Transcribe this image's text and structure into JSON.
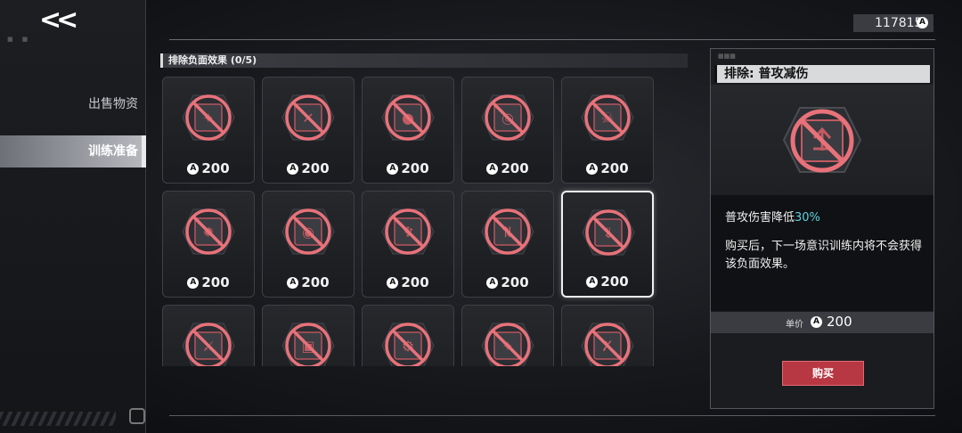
{
  "nav": {
    "back_label": "<<"
  },
  "sidebar": {
    "items": [
      {
        "label": "出售物资",
        "active": false
      },
      {
        "label": "训练准备",
        "active": true
      }
    ]
  },
  "currency": {
    "amount": "117815",
    "icon": "A"
  },
  "section": {
    "title": "排除负面效果 (0/5)"
  },
  "grid": {
    "cards": [
      {
        "price": "200",
        "icon": "no-star-badge-icon",
        "selected": false
      },
      {
        "price": "200",
        "icon": "no-broken-shield-icon",
        "selected": false
      },
      {
        "price": "200",
        "icon": "no-bomb-icon",
        "selected": false
      },
      {
        "price": "200",
        "icon": "no-aperture-icon",
        "selected": false
      },
      {
        "price": "200",
        "icon": "no-skull-icon",
        "selected": false
      },
      {
        "price": "200",
        "icon": "no-flame-burst-icon",
        "selected": false
      },
      {
        "price": "200",
        "icon": "no-vortex-icon",
        "selected": false
      },
      {
        "price": "200",
        "icon": "no-demon-icon",
        "selected": false
      },
      {
        "price": "200",
        "icon": "no-swap-arrows-icon",
        "selected": false
      },
      {
        "price": "200",
        "icon": "no-attack-down-icon",
        "selected": true
      },
      {
        "price": "",
        "icon": "no-sword-icon",
        "selected": false
      },
      {
        "price": "",
        "icon": "no-cube-icon",
        "selected": false
      },
      {
        "price": "",
        "icon": "no-gear-skull-icon",
        "selected": false
      },
      {
        "price": "",
        "icon": "no-compass-icon",
        "selected": false
      },
      {
        "price": "",
        "icon": "no-crossed-icon",
        "selected": false
      }
    ]
  },
  "detail": {
    "title": "排除: 普攻减伤",
    "icon": "no-attack-down-icon",
    "desc_prefix": "普攻伤害降低",
    "desc_highlight": "30%",
    "desc_body": "购买后，下一场意识训练内将不会获得该负面效果。",
    "unit_price_label": "单价",
    "unit_price_value": "200",
    "buy_label": "购买"
  },
  "colors": {
    "accent_red": "#b73742",
    "highlight_cyan": "#5fd0e0",
    "no_symbol": "#e8727a"
  }
}
